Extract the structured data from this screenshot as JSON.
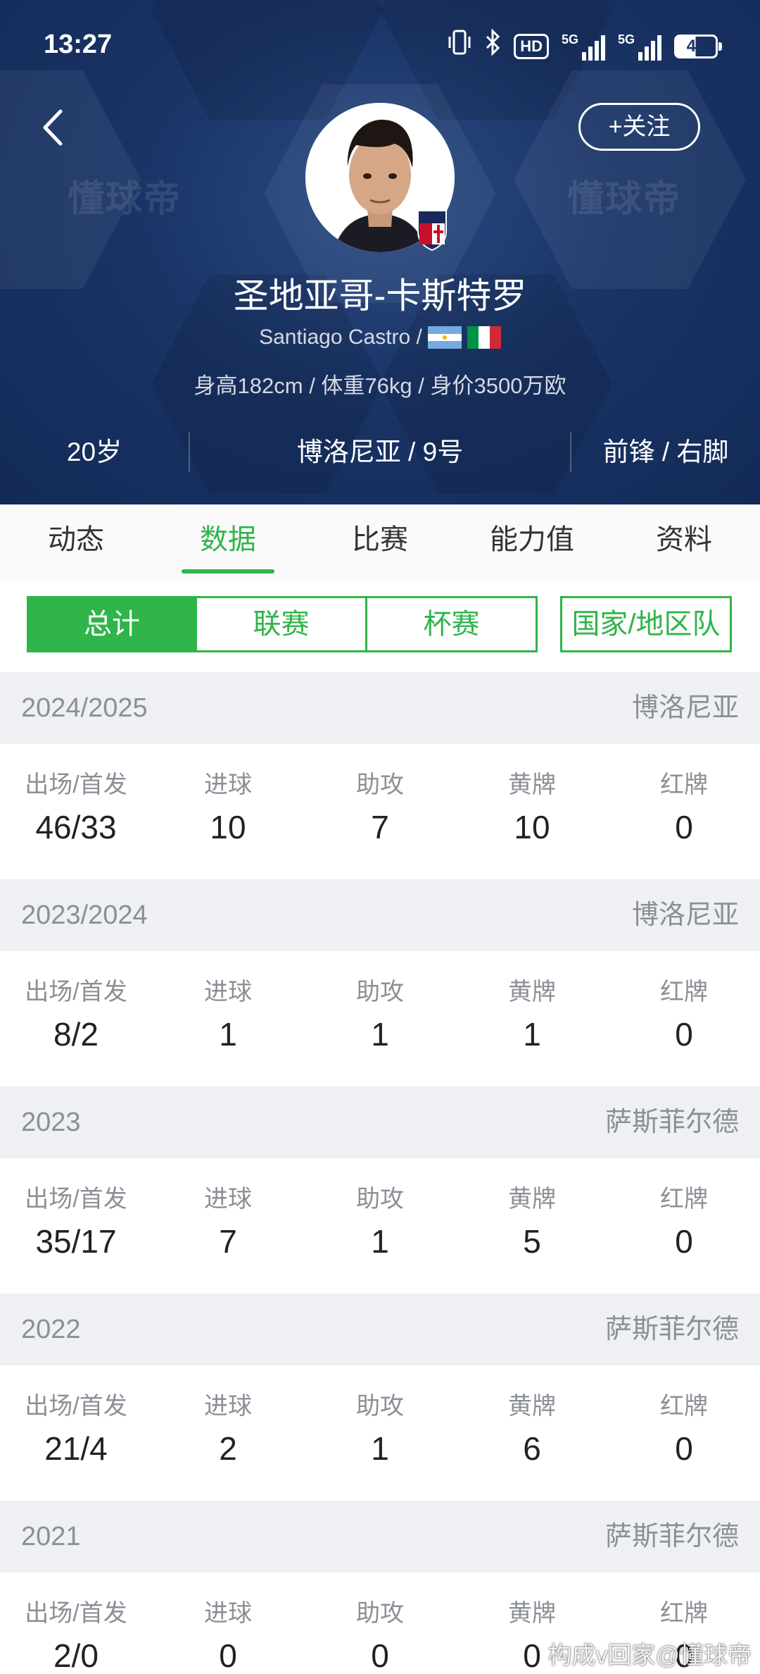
{
  "status_bar": {
    "time": "13:27",
    "hd": "HD",
    "net1": "5G",
    "net2": "5G",
    "battery": "49"
  },
  "header": {
    "watermark": "懂球帝",
    "follow_label": "+关注",
    "player_name": "圣地亚哥-卡斯特罗",
    "english_name": "Santiago Castro /",
    "bio": "身高182cm / 体重76kg / 身价3500万欧",
    "age": "20岁",
    "club_number": "博洛尼亚 / 9号",
    "position_foot": "前锋 / 右脚"
  },
  "tabs": [
    "动态",
    "数据",
    "比赛",
    "能力值",
    "资料"
  ],
  "active_tab": "数据",
  "segments": [
    "总计",
    "联赛",
    "杯赛"
  ],
  "national_segment": "国家/地区队",
  "stat_labels": [
    "出场/首发",
    "进球",
    "助攻",
    "黄牌",
    "红牌"
  ],
  "seasons": [
    {
      "year": "2024/2025",
      "club": "博洛尼亚",
      "values": [
        "46/33",
        "10",
        "7",
        "10",
        "0"
      ]
    },
    {
      "year": "2023/2024",
      "club": "博洛尼亚",
      "values": [
        "8/2",
        "1",
        "1",
        "1",
        "0"
      ]
    },
    {
      "year": "2023",
      "club": "萨斯菲尔德",
      "values": [
        "35/17",
        "7",
        "1",
        "5",
        "0"
      ]
    },
    {
      "year": "2022",
      "club": "萨斯菲尔德",
      "values": [
        "21/4",
        "2",
        "1",
        "6",
        "0"
      ]
    },
    {
      "year": "2021",
      "club": "萨斯菲尔德",
      "values": [
        "2/0",
        "0",
        "0",
        "0",
        "0"
      ]
    }
  ],
  "footer_watermark": "构成v回家@懂球帝",
  "colors": {
    "accent": "#2fb54a",
    "header_bg": "#1a3466"
  }
}
